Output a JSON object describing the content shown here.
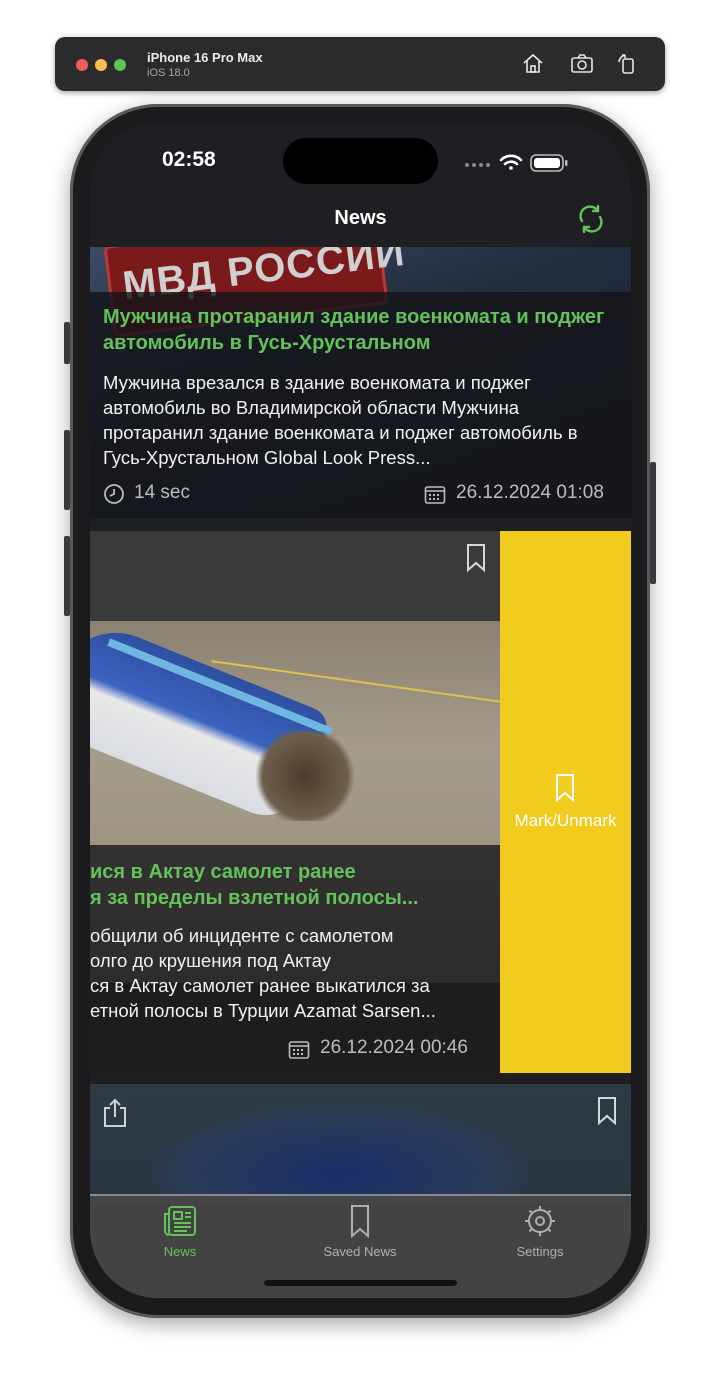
{
  "simulator": {
    "device_name": "iPhone 16 Pro Max",
    "os_version": "iOS 18.0",
    "toolbar_icons": [
      "home-icon",
      "screenshot-icon",
      "rotate-icon"
    ]
  },
  "status_bar": {
    "time": "02:58"
  },
  "nav": {
    "title": "News",
    "refresh_icon": "refresh-icon",
    "accent_color": "#63c35a"
  },
  "articles": [
    {
      "image_text": "МВД РОССИИ",
      "headline": "Мужчина протаранил здание военкомата и поджег автомобиль в Гусь-Хрустальном",
      "description": "Мужчина врезался в здание военкомата и поджег автомобиль во Владимирской области Мужчина протаранил здание военкомата и поджег автомобиль в Гусь-Хрустальном Global Look Press...",
      "read_time": "14 sec",
      "date": "26.12.2024 01:08"
    },
    {
      "headline": "ися в Актау самолет ранее я за пределы взлетной полосы...",
      "headline_line1": "ися в Актау самолет ранее",
      "headline_line2": "я за пределы взлетной полосы...",
      "description_line1": "общили об инциденте с самолетом",
      "description_line2": "олго до крушения под Актау",
      "description_line3": "ся в Актау самолет ранее выкатился за",
      "description_line4": "етной полосы в Турции Azamat Sarsen...",
      "date": "26.12.2024 00:46"
    },
    {}
  ],
  "swipe_action": {
    "label": "Mark/Unmark",
    "color": "#f2cb1f"
  },
  "tabs": [
    {
      "label": "News",
      "icon": "newspaper-icon",
      "active": true
    },
    {
      "label": "Saved News",
      "icon": "bookmark-icon",
      "active": false
    },
    {
      "label": "Settings",
      "icon": "gear-icon",
      "active": false
    }
  ]
}
